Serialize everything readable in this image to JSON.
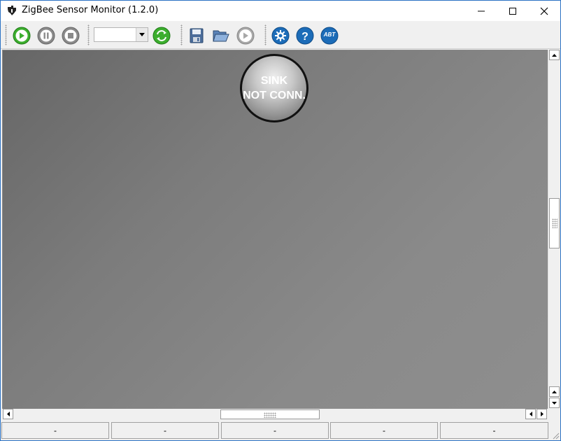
{
  "window": {
    "title": "ZigBee Sensor Monitor (1.2.0)",
    "controls": {
      "minimize": "minimize-icon",
      "maximize": "maximize-icon",
      "close": "close-icon"
    }
  },
  "toolbar": {
    "buttons": [
      {
        "icon": "play-icon",
        "color": "#3cae2e"
      },
      {
        "icon": "pause-icon",
        "color": "#8a8a8a"
      },
      {
        "icon": "stop-icon",
        "color": "#8a8a8a"
      },
      {
        "icon": "refresh-icon",
        "color": "#3cae2e"
      },
      {
        "icon": "save-icon"
      },
      {
        "icon": "open-folder-icon"
      },
      {
        "icon": "replay-icon"
      },
      {
        "icon": "settings-icon",
        "color": "#1c6cb8"
      },
      {
        "icon": "help-icon",
        "color": "#1c6cb8"
      },
      {
        "icon": "about-icon",
        "label": "ABT",
        "color": "#1c6cb8"
      }
    ],
    "port_select": {
      "value": ""
    }
  },
  "canvas": {
    "sink_node": {
      "line1": "SINK",
      "line2": "NOT CONN."
    }
  },
  "status": [
    "-",
    "-",
    "-",
    "-",
    "-"
  ],
  "colors": {
    "accent": "#2b72c4",
    "canvas": "#7a7a7a"
  }
}
